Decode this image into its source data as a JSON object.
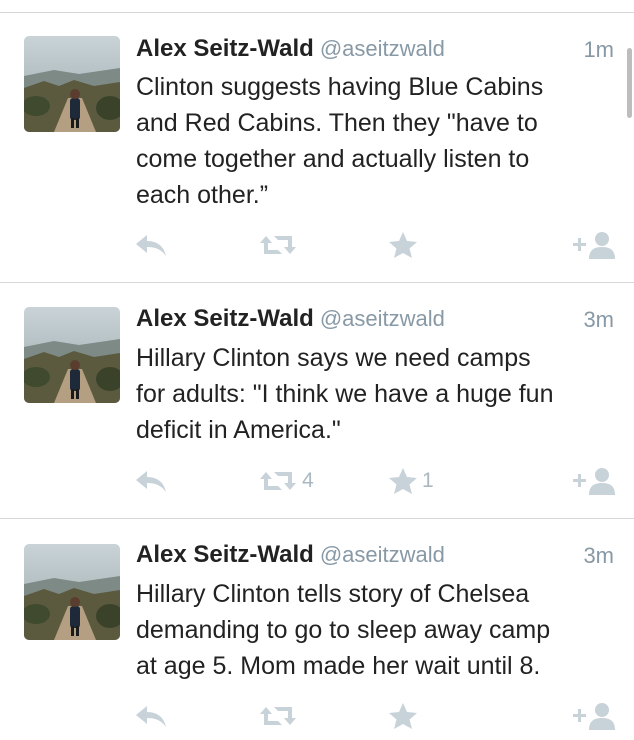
{
  "tweets": [
    {
      "name": "Alex Seitz-Wald",
      "handle": "@aseitzwald",
      "time": "1m",
      "lines": [
        "Clinton suggests having Blue Cabins",
        "and Red Cabins. Then they \"have to",
        "come together and actually listen to",
        "each other.”"
      ],
      "retweets": "",
      "favorites": ""
    },
    {
      "name": "Alex Seitz-Wald",
      "handle": "@aseitzwald",
      "time": "3m",
      "lines": [
        "Hillary Clinton says we need camps",
        "for adults: \"I think we have a huge fun",
        "deficit in America.\""
      ],
      "retweets": "4",
      "favorites": "1"
    },
    {
      "name": "Alex Seitz-Wald",
      "handle": "@aseitzwald",
      "time": "3m",
      "lines": [
        "Hillary Clinton tells story of Chelsea",
        "demanding to go to sleep away camp",
        "at age 5. Mom made her wait until 8."
      ],
      "retweets": "",
      "favorites": ""
    }
  ],
  "icons": {
    "reply": "reply-icon",
    "retweet": "retweet-icon",
    "favorite": "star-icon",
    "follow": "follow-icon"
  },
  "colors": {
    "icon": "#c8d2d9",
    "meta": "#8899a6",
    "text": "#222222",
    "divider": "#d8d8dc"
  }
}
